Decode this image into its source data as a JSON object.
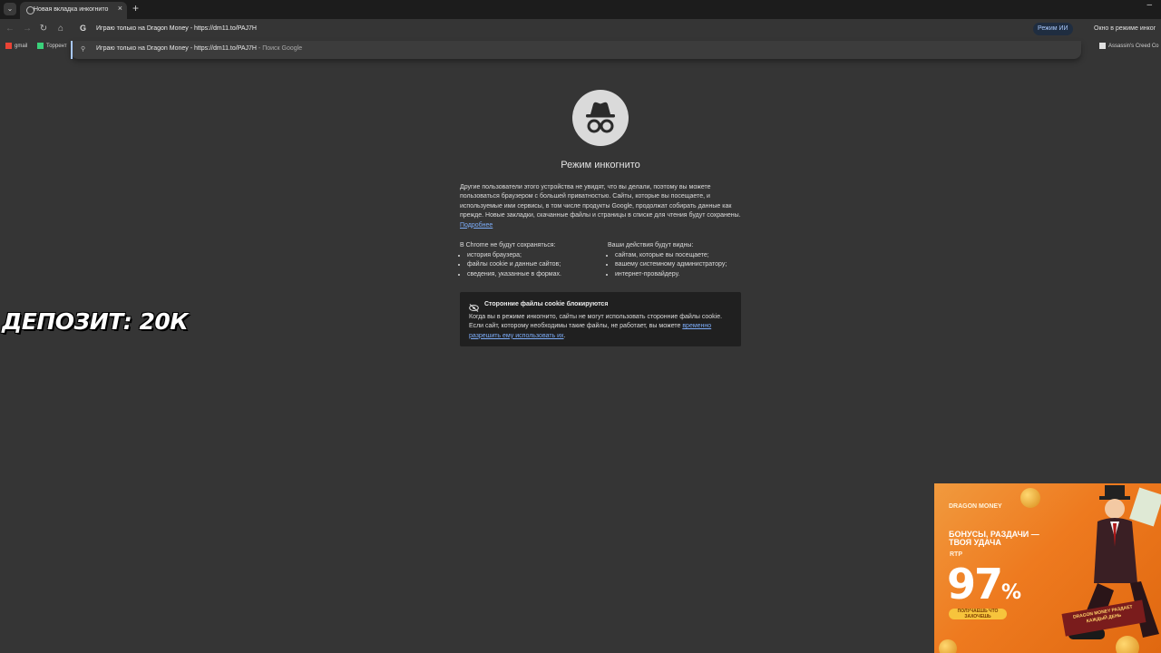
{
  "browser": {
    "tab_title": "Новая вкладка инкогнито",
    "address_text": "Играю только на Dragon Money - https://dm11.to/PAJ7H",
    "ai_mode_label": "Режим ИИ",
    "incognito_chip": "Окно в режиме инког"
  },
  "suggestion": {
    "text": "Играю только на Dragon Money - https://dm11.to/PAJ7H",
    "suffix": " - Поиск Google"
  },
  "bookmarks": {
    "gmail": "gmail",
    "torrent": "Торрент",
    "right": "Assassin's Creed Co"
  },
  "incognito": {
    "title": "Режим инкогнито",
    "intro": "Другие пользователи этого устройства не увидят, что вы делали, поэтому вы можете пользоваться браузером с большей приватностью. Сайты, которые вы посещаете, и используемые ими сервисы, в том числе продукты Google, продолжат собирать данные как прежде. Новые закладки, скачанные файлы и страницы в списке для чтения будут сохранены.",
    "learn_more": "Подробнее",
    "not_saved_heading": "В Chrome не будут сохраняться:",
    "not_saved": [
      "история браузера;",
      "файлы cookie и данные сайтов;",
      "сведения, указанные в формах."
    ],
    "visible_heading": "Ваши действия будут видны:",
    "visible": [
      "сайтам, которые вы посещаете;",
      "вашему системному администратору;",
      "интернет-провайдеру."
    ],
    "cookie_title": "Сторонние файлы cookie блокируются",
    "cookie_body": "Когда вы в режиме инкогнито, сайты не могут использовать сторонние файлы cookie. Если сайт, которому необходимы такие файлы, не работает, вы можете",
    "cookie_link": "временно разрешить ему использовать их"
  },
  "overlay": {
    "deposit": "ДЕПОЗИТ: 20К"
  },
  "promo": {
    "brand": "DRAGON MONEY",
    "headline": "БОНУСЫ, РАЗДАЧИ — ТВОЯ УДАЧА",
    "rtp_label": "RTP",
    "rtp_value": "97",
    "rtp_unit": "%",
    "pill": "ПОЛУЧАЕШЬ ЧТО ЗАХОЧЕШЬ",
    "banner": "DRAGON MONEY РАЗДАЕТ КАЖДЫЙ ДЕНЬ"
  }
}
